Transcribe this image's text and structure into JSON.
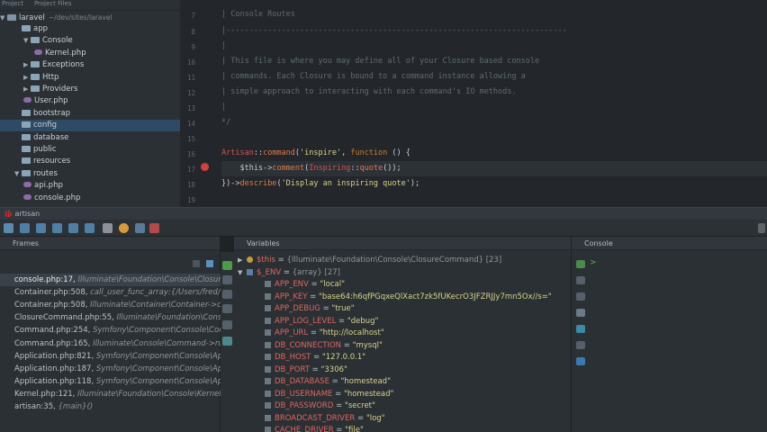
{
  "project_panel": {
    "tabs": [
      "Project",
      "Project Files"
    ],
    "root": {
      "name": "laravel",
      "path": "~/dev/sites/laravel"
    },
    "tree": [
      {
        "label": "app",
        "kind": "folder"
      },
      {
        "label": "Console",
        "kind": "folder"
      },
      {
        "label": "Kernel.php",
        "kind": "file"
      },
      {
        "label": "Exceptions",
        "kind": "folder"
      },
      {
        "label": "Http",
        "kind": "folder"
      },
      {
        "label": "Providers",
        "kind": "folder"
      },
      {
        "label": "User.php",
        "kind": "file"
      },
      {
        "label": "bootstrap",
        "kind": "folder"
      },
      {
        "label": "config",
        "kind": "folder"
      },
      {
        "label": "database",
        "kind": "folder"
      },
      {
        "label": "public",
        "kind": "folder"
      },
      {
        "label": "resources",
        "kind": "folder"
      },
      {
        "label": "routes",
        "kind": "folder"
      },
      {
        "label": "api.php",
        "kind": "file"
      },
      {
        "label": "console.php",
        "kind": "file"
      }
    ],
    "selected": "config"
  },
  "editor": {
    "lines": [
      {
        "n": "7",
        "text": "| Console Routes"
      },
      {
        "n": "8",
        "text": "|--------------------------------------------------------------------------"
      },
      {
        "n": "9",
        "text": "|"
      },
      {
        "n": "10",
        "text": "| This file is where you may define all of your Closure based console"
      },
      {
        "n": "11",
        "text": "| commands. Each Closure is bound to a command instance allowing a"
      },
      {
        "n": "12",
        "text": "| simple approach to interacting with each command's IO methods."
      },
      {
        "n": "13",
        "text": "|"
      },
      {
        "n": "14",
        "text": "*/"
      },
      {
        "n": "15",
        "text": ""
      },
      {
        "n": "16",
        "text": "Artisan::command('inspire', function () {"
      },
      {
        "n": "17",
        "text": "    $this->comment(Inspiring::quote());"
      },
      {
        "n": "18",
        "text": "})->describe('Display an inspiring quote');"
      },
      {
        "n": "19",
        "text": ""
      }
    ],
    "current_line": "17"
  },
  "debug": {
    "session_label": "artisan",
    "frames_title": "Frames",
    "variables_title": "Variables",
    "console_title": "Console",
    "frames": [
      {
        "file": "console.php:17,",
        "cls": "Illuminate\\Foundation\\Console\\ClosureCommand"
      },
      {
        "file": "Container.php:508,",
        "cls": "call_user_func_array:{/Users/fred/dev/sites"
      },
      {
        "file": "Container.php:508,",
        "cls": "Illuminate\\Container\\Container->call()"
      },
      {
        "file": "ClosureCommand.php:55,",
        "cls": "Illuminate\\Foundation\\Console\\Closure"
      },
      {
        "file": "Command.php:254,",
        "cls": "Symfony\\Component\\Console\\Command"
      },
      {
        "file": "Command.php:165,",
        "cls": "Illuminate\\Console\\Command->run()"
      },
      {
        "file": "Application.php:821,",
        "cls": "Symfony\\Component\\Console\\Application"
      },
      {
        "file": "Application.php:187,",
        "cls": "Symfony\\Component\\Console\\Application"
      },
      {
        "file": "Application.php:118,",
        "cls": "Symfony\\Component\\Console\\Application"
      },
      {
        "file": "Kernel.php:121,",
        "cls": "Illuminate\\Foundation\\Console\\Kernel"
      },
      {
        "file": "artisan:35,",
        "cls": "{main}()"
      }
    ],
    "this_var": {
      "name": "$this",
      "value": "{Illuminate\\Foundation\\Console\\ClosureCommand} [23]"
    },
    "env_var": {
      "name": "$_ENV",
      "value": "{array} [27]"
    },
    "env": [
      {
        "k": "APP_ENV",
        "v": "\"local\""
      },
      {
        "k": "APP_KEY",
        "v": "\"base64:h6qfPGqxeQlXact7zk5fUKecrO3JFZRJJy7mn5Ox//s=\""
      },
      {
        "k": "APP_DEBUG",
        "v": "\"true\""
      },
      {
        "k": "APP_LOG_LEVEL",
        "v": "\"debug\""
      },
      {
        "k": "APP_URL",
        "v": "\"http://localhost\""
      },
      {
        "k": "DB_CONNECTION",
        "v": "\"mysql\""
      },
      {
        "k": "DB_HOST",
        "v": "\"127.0.0.1\""
      },
      {
        "k": "DB_PORT",
        "v": "\"3306\""
      },
      {
        "k": "DB_DATABASE",
        "v": "\"homestead\""
      },
      {
        "k": "DB_USERNAME",
        "v": "\"homestead\""
      },
      {
        "k": "DB_PASSWORD",
        "v": "\"secret\""
      },
      {
        "k": "BROADCAST_DRIVER",
        "v": "\"log\""
      },
      {
        "k": "CACHE_DRIVER",
        "v": "\"file\""
      }
    ],
    "console_prompt": ">"
  },
  "colors": {
    "accent_selection": "#2e4a64",
    "breakpoint": "#d0413c",
    "string": "#d6d28a",
    "var_name": "#e0665e"
  }
}
